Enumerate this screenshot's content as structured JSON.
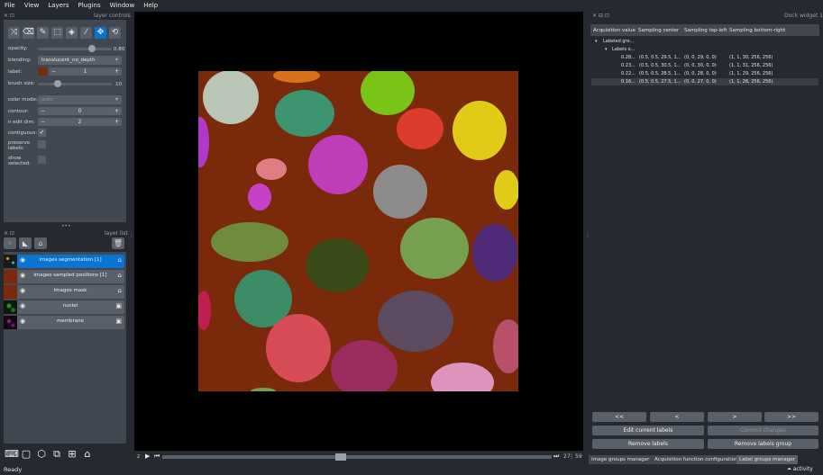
{
  "menu": [
    "File",
    "View",
    "Layers",
    "Plugins",
    "Window",
    "Help"
  ],
  "layer_controls": {
    "title": "layer controls",
    "opacity_label": "opacity:",
    "opacity_value": "0.80",
    "blending_label": "blending:",
    "blending_value": "translucent_no_depth",
    "label_label": "label:",
    "label_value": "1",
    "brush_label": "brush size:",
    "brush_value": "10",
    "color_mode_label": "color mode:",
    "color_mode_value": "auto",
    "contour_label": "contour:",
    "contour_value": "0",
    "nedit_label": "n edit dim:",
    "nedit_value": "2",
    "contiguous_label": "contiguous:",
    "preserve_label": "preserve labels:",
    "show_selected_label": "show selected:",
    "minus": "−",
    "plus": "+"
  },
  "layer_list": {
    "title": "layer list",
    "layers": [
      {
        "name": "images segmentation [1]",
        "selected": true
      },
      {
        "name": "images sampled positions [1]",
        "selected": false
      },
      {
        "name": "images mask",
        "selected": false
      },
      {
        "name": "nuclei",
        "selected": false
      },
      {
        "name": "membrane",
        "selected": false
      }
    ]
  },
  "dock": {
    "title": "Dock widget 1",
    "columns": [
      "Acquisition value",
      "Sampling center",
      "Sampling top-left",
      "Sampling bottom-right"
    ],
    "tree_root": "Labeled gro...",
    "tree_child": "Labels o...",
    "rows": [
      {
        "value": "0.28...",
        "center": "(0.5, 0.5, 29.5, 1...",
        "top_left": "(0, 0, 29, 0, 0)",
        "bottom_right": "(1, 1, 30, 256, 256)"
      },
      {
        "value": "0.23...",
        "center": "(0.5, 0.5, 30.5, 1...",
        "top_left": "(0, 0, 30, 0, 0)",
        "bottom_right": "(1, 1, 31, 256, 256)"
      },
      {
        "value": "0.22...",
        "center": "(0.5, 0.5, 28.5, 1...",
        "top_left": "(0, 0, 28, 0, 0)",
        "bottom_right": "(1, 1, 29, 256, 256)"
      },
      {
        "value": "0.16...",
        "center": "(0.5, 0.5, 27.5, 1...",
        "top_left": "(0, 0, 27, 0, 0)",
        "bottom_right": "(1, 1, 28, 256, 256)"
      }
    ],
    "nav": [
      "<<",
      "<",
      ">",
      ">>"
    ],
    "edit_current": "Edit current labels",
    "commit": "Commit changes",
    "remove_labels": "Remove labels",
    "remove_group": "Remove labels group"
  },
  "tabs": [
    "Image groups manager",
    "Acquisition function configuration",
    "Label groups manager"
  ],
  "slider": {
    "current": "27",
    "total": "59"
  },
  "status": {
    "left": "Ready",
    "right": "activity"
  },
  "colors": {
    "background_label": "#7a2a0a"
  }
}
